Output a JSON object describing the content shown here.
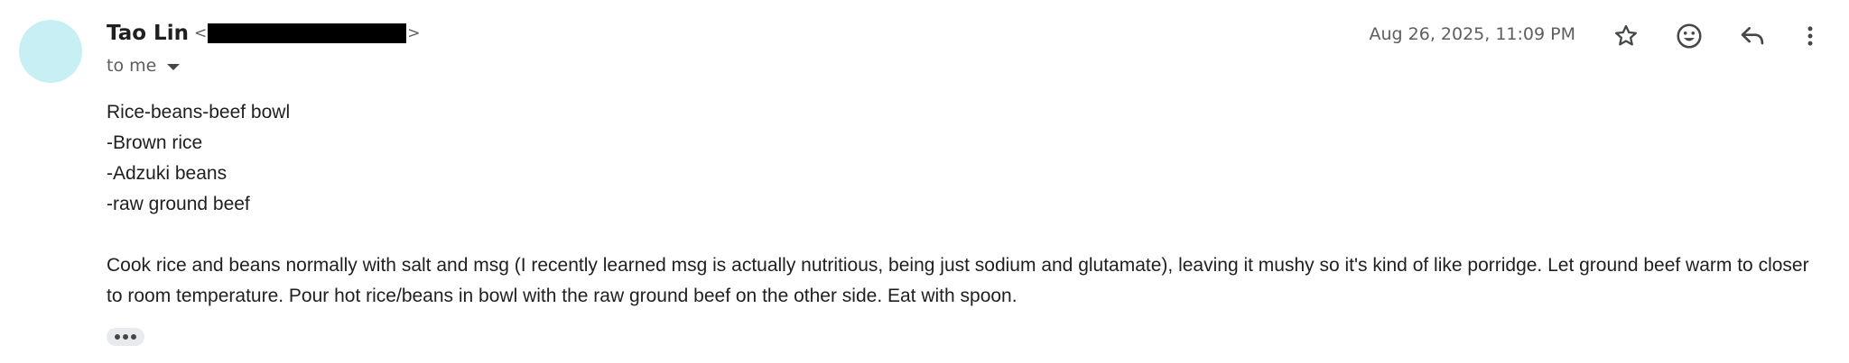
{
  "theme": {
    "avatar_color": "#c8f0f4",
    "text_color": "#1f1f1f",
    "muted_text_color": "#5e5e5e",
    "icon_color": "#444746"
  },
  "message": {
    "sender": {
      "name": "Tao Lin",
      "email_open": "<",
      "email_close": ">"
    },
    "recipient_label": "to me",
    "date": "Aug 26, 2025, 11:09 PM",
    "actions": {
      "star_icon": "star-icon",
      "emoji_icon": "emoji-icon",
      "reply_icon": "reply-icon",
      "more_icon": "more-vert-icon"
    },
    "body": {
      "lines": [
        "Rice-beans-beef bowl",
        "-Brown rice",
        "-Adzuki beans",
        "-raw ground beef"
      ],
      "paragraph": "Cook rice and beans normally with salt and msg (I recently learned msg is actually nutritious, being just sodium and glutamate), leaving it mushy so it's kind of like porridge. Let ground beef warm to closer to room temperature. Pour hot rice/beans in bowl with the raw ground beef on the other side. Eat with spoon."
    }
  }
}
